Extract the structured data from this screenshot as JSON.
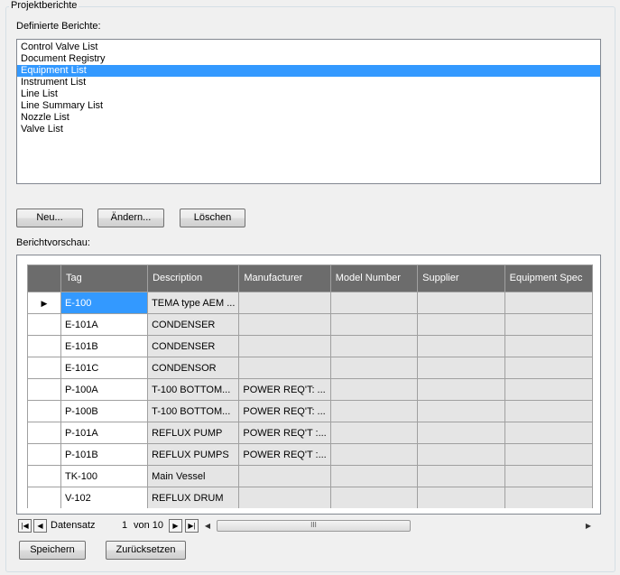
{
  "group_title": "Projektberichte",
  "reports_label": "Definierte Berichte:",
  "reports": [
    "Control Valve List",
    "Document Registry",
    "Equipment List",
    "Instrument List",
    "Line List",
    "Line Summary List",
    "Nozzle List",
    "Valve List"
  ],
  "selected_report": "Equipment List",
  "buttons": {
    "new": "Neu...",
    "edit": "Ändern...",
    "delete": "Löschen",
    "save": "Speichern",
    "reset": "Zurücksetzen"
  },
  "preview_label": "Berichtvorschau:",
  "grid": {
    "columns": [
      "Tag",
      "Description",
      "Manufacturer",
      "Model Number",
      "Supplier",
      "Equipment Spec"
    ],
    "rows": [
      [
        "E-100",
        "TEMA type AEM ...",
        "",
        "",
        "",
        ""
      ],
      [
        "E-101A",
        "CONDENSER",
        "",
        "",
        "",
        ""
      ],
      [
        "E-101B",
        "CONDENSER",
        "",
        "",
        "",
        ""
      ],
      [
        "E-101C",
        "CONDENSOR",
        "",
        "",
        "",
        ""
      ],
      [
        "P-100A",
        "T-100 BOTTOM...",
        "POWER REQ'T: ...",
        "",
        "",
        ""
      ],
      [
        "P-100B",
        "T-100 BOTTOM...",
        "POWER REQ'T: ...",
        "",
        "",
        ""
      ],
      [
        "P-101A",
        "REFLUX PUMP",
        "POWER REQ'T :...",
        "",
        "",
        ""
      ],
      [
        "P-101B",
        "REFLUX PUMPS",
        "POWER REQ'T :...",
        "",
        "",
        ""
      ],
      [
        "TK-100",
        "Main Vessel",
        "",
        "",
        "",
        ""
      ],
      [
        "V-102",
        "REFLUX DRUM",
        "",
        "",
        "",
        ""
      ]
    ],
    "current_row_marker": "▶"
  },
  "navigator": {
    "record_label": "Datensatz",
    "current_record": "1",
    "of_label": "von 10",
    "first_icon": "first-record-icon",
    "prev_icon": "previous-record-icon",
    "next_icon": "next-record-icon",
    "last_icon": "last-record-icon",
    "scroll_grip": "III"
  },
  "colors": {
    "selection": "#3399ff",
    "grid_header": "#6c6c6c",
    "cell_bg": "#e5e5e5"
  }
}
